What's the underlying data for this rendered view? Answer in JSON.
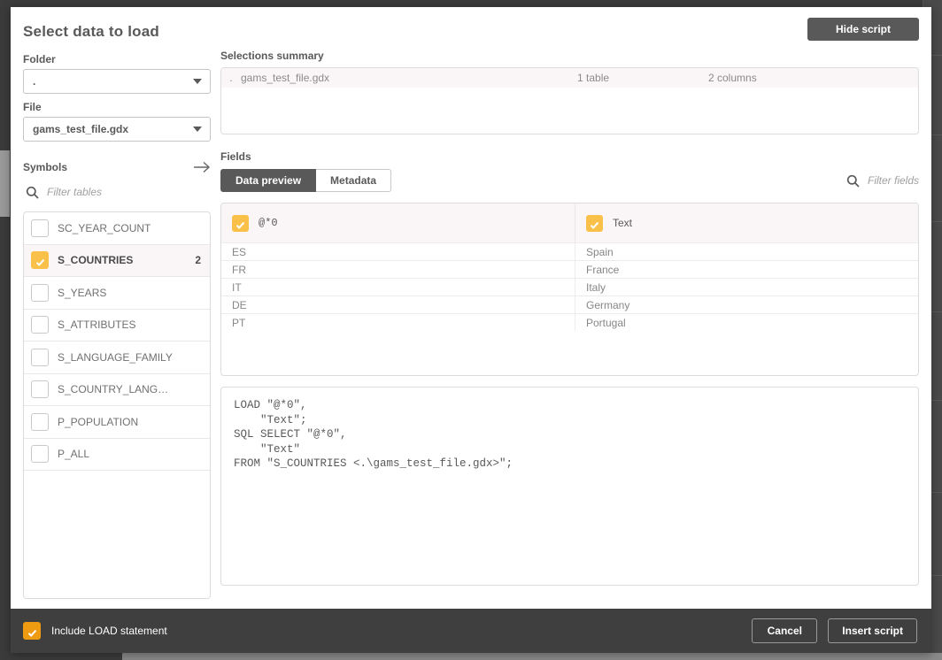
{
  "dialog": {
    "title": "Select data to load",
    "hide_script_button": "Hide script"
  },
  "left_panel": {
    "folder_label": "Folder",
    "folder_value": ".",
    "file_label": "File",
    "file_value": "gams_test_file.gdx",
    "symbols_label": "Symbols",
    "symbols_arrow_icon": "arrow-right-icon",
    "filter_tables_placeholder": "Filter tables",
    "search_icon": "search-icon",
    "symbols": [
      {
        "name": "SC_YEAR_COUNT",
        "checked": false,
        "count": ""
      },
      {
        "name": "S_COUNTRIES",
        "checked": true,
        "count": "2"
      },
      {
        "name": "S_YEARS",
        "checked": false,
        "count": ""
      },
      {
        "name": "S_ATTRIBUTES",
        "checked": false,
        "count": ""
      },
      {
        "name": "S_LANGUAGE_FAMILY",
        "checked": false,
        "count": ""
      },
      {
        "name": "S_COUNTRY_LANG…",
        "checked": false,
        "count": ""
      },
      {
        "name": "P_POPULATION",
        "checked": false,
        "count": ""
      },
      {
        "name": "P_ALL",
        "checked": false,
        "count": ""
      }
    ]
  },
  "right_panel": {
    "selections_summary_label": "Selections summary",
    "summary_row": {
      "folder": ".",
      "file": "gams_test_file.gdx",
      "tables": "1 table",
      "columns": "2 columns"
    },
    "fields_label": "Fields",
    "tabs": [
      {
        "label": "Data preview",
        "active": true
      },
      {
        "label": "Metadata",
        "active": false
      }
    ],
    "filter_fields_placeholder": "Filter fields",
    "filter_fields_icon": "search-icon",
    "data_preview": {
      "columns": [
        {
          "name": "@*0",
          "checked": true,
          "mono": true
        },
        {
          "name": "Text",
          "checked": true,
          "mono": false
        }
      ],
      "rows": [
        [
          "ES",
          "Spain"
        ],
        [
          "FR",
          "France"
        ],
        [
          "IT",
          "Italy"
        ],
        [
          "DE",
          "Germany"
        ],
        [
          "PT",
          "Portugal"
        ]
      ]
    },
    "script": "LOAD \"@*0\",\n    \"Text\";\nSQL SELECT \"@*0\",\n    \"Text\"\nFROM \"S_COUNTRIES <.\\gams_test_file.gdx>\";"
  },
  "footer": {
    "include_load_label": "Include LOAD statement",
    "include_load_checked": true,
    "cancel_button": "Cancel",
    "insert_script_button": "Insert script"
  },
  "colors": {
    "accent_yellow": "#f9c149",
    "accent_orange": "#ef9b12",
    "dark_chrome": "#3f3f3f",
    "tab_active": "#595959",
    "selected_row": "#faf6f7"
  }
}
